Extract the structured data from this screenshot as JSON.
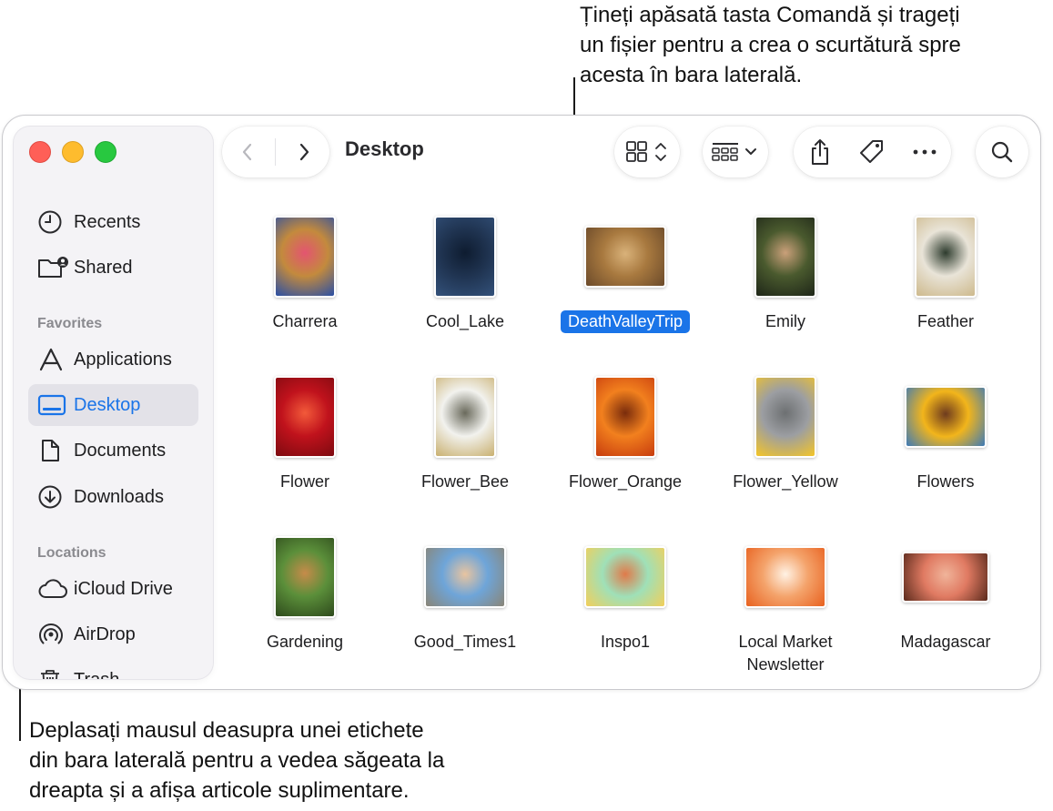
{
  "callouts": {
    "top": [
      "Țineți apăsată tasta Comandă și trageți",
      "un fișier pentru a crea o scurtătură spre",
      "acesta în bara laterală."
    ],
    "bottom": [
      "Deplasați mausul deasupra unei etichete",
      "din bara laterală pentru a vedea săgeata la",
      "dreapta și a afișa articole suplimentare."
    ]
  },
  "window": {
    "title": "Desktop"
  },
  "sidebar": {
    "top_items": [
      {
        "label": "Recents",
        "icon": "clock-icon"
      },
      {
        "label": "Shared",
        "icon": "shared-folder-icon"
      }
    ],
    "favorites_header": "Favorites",
    "favorites": [
      {
        "label": "Applications",
        "icon": "applications-icon"
      },
      {
        "label": "Desktop",
        "icon": "desktop-icon",
        "selected": true
      },
      {
        "label": "Documents",
        "icon": "document-icon"
      },
      {
        "label": "Downloads",
        "icon": "download-icon"
      }
    ],
    "locations_header": "Locations",
    "locations": [
      {
        "label": "iCloud Drive",
        "icon": "cloud-icon"
      },
      {
        "label": "AirDrop",
        "icon": "airdrop-icon"
      },
      {
        "label": "Trash",
        "icon": "trash-icon"
      }
    ]
  },
  "toolbar": {
    "icons": [
      "back-icon",
      "forward-icon",
      "icon-view-icon",
      "group-icon",
      "share-icon",
      "tag-icon",
      "more-icon",
      "search-icon"
    ]
  },
  "files": [
    {
      "name": "Charrera",
      "colors": [
        "#c38a3d",
        "#2a4fa5",
        "#e35570"
      ]
    },
    {
      "name": "Cool_Lake",
      "colors": [
        "#1f3350",
        "#33517a",
        "#0e1c30"
      ]
    },
    {
      "name": "DeathValleyTrip",
      "colors": [
        "#a8793f",
        "#6b4a2a",
        "#d9b27a"
      ],
      "selected": true
    },
    {
      "name": "Emily",
      "colors": [
        "#4a5a2e",
        "#1e2618",
        "#caa07a"
      ]
    },
    {
      "name": "Feather",
      "colors": [
        "#e9e4d8",
        "#cdb98c",
        "#2e3c2e"
      ]
    },
    {
      "name": "Flower",
      "colors": [
        "#c0121c",
        "#7d0a10",
        "#f25a3a"
      ]
    },
    {
      "name": "Flower_Bee",
      "colors": [
        "#f2f2ee",
        "#c9b070",
        "#6a6a5c"
      ]
    },
    {
      "name": "Flower_Orange",
      "colors": [
        "#f2801e",
        "#c73c0e",
        "#7a2c0c"
      ]
    },
    {
      "name": "Flower_Yellow",
      "colors": [
        "#9c9ea2",
        "#f4c527",
        "#6d7072"
      ]
    },
    {
      "name": "Flowers",
      "colors": [
        "#f2b51b",
        "#3d7ab7",
        "#6e3b1e"
      ]
    },
    {
      "name": "Gardening",
      "colors": [
        "#5b8f3a",
        "#2e4a1c",
        "#c68b4a"
      ]
    },
    {
      "name": "Good_Times1",
      "colors": [
        "#6ea5d9",
        "#8a8577",
        "#e8c4a0"
      ]
    },
    {
      "name": "Inspo1",
      "colors": [
        "#9fe0b8",
        "#f2cf5a",
        "#e07a4a"
      ]
    },
    {
      "name": "Local Market\nNewsletter",
      "colors": [
        "#f4a36b",
        "#e8611f",
        "#fff2e4"
      ]
    },
    {
      "name": "Madagascar",
      "colors": [
        "#e07a62",
        "#5a2a1c",
        "#f0b49a"
      ]
    }
  ]
}
